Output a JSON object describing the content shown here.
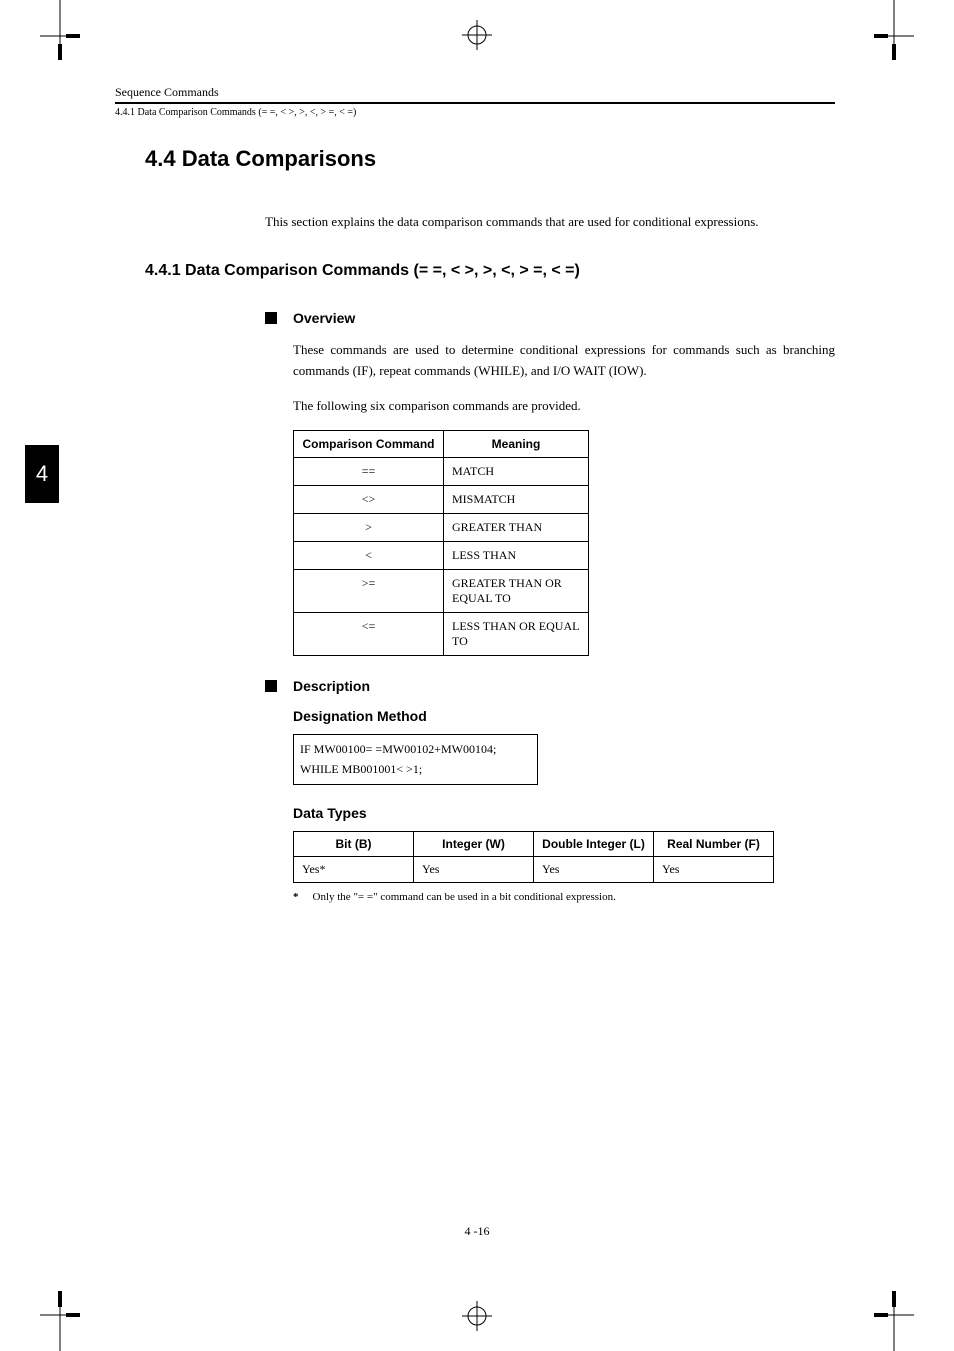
{
  "running_head": "Sequence Commands",
  "sub_head": "4.4.1  Data Comparison Commands (= =, < >, >, <, > =, < =)",
  "section_title": "4.4  Data Comparisons",
  "chapter_tab": "4",
  "intro_text": "This section explains the data comparison commands that are used for conditional expressions.",
  "subsection_title": "4.4.1  Data Comparison Commands (= =, < >, >, <, > =, < =)",
  "overview": {
    "heading": "Overview",
    "p1": "These commands are used to determine conditional expressions for commands such as branching commands (IF), repeat commands (WHILE), and I/O WAIT (IOW).",
    "p2": "The following six comparison commands are provided."
  },
  "comparison_table": {
    "headers": {
      "cmd": "Comparison Command",
      "mean": "Meaning"
    },
    "rows": [
      {
        "cmd": "==",
        "mean": "MATCH"
      },
      {
        "cmd": "<>",
        "mean": "MISMATCH"
      },
      {
        "cmd": ">",
        "mean": "GREATER THAN"
      },
      {
        "cmd": "<",
        "mean": "LESS THAN"
      },
      {
        "cmd": ">=",
        "mean": "GREATER THAN OR EQUAL TO"
      },
      {
        "cmd": "<=",
        "mean": "LESS THAN OR EQUAL TO"
      }
    ]
  },
  "description": {
    "heading": "Description",
    "designation_heading": "Designation Method",
    "code": {
      "line1": "IF    MW00100= =MW00102+MW00104;",
      "line2": "WHILE   MB001001< >1;"
    },
    "types_heading": "Data Types",
    "types_headers": {
      "b": "Bit (B)",
      "w": "Integer (W)",
      "l": "Double Integer (L)",
      "f": "Real Number (F)"
    },
    "types_row": {
      "b": "Yes*",
      "w": "Yes",
      "l": "Yes",
      "f": "Yes"
    },
    "footnote_mark": "*",
    "footnote_text": "Only the \"= =\" command can be used in a bit conditional expression."
  },
  "page_number": "4 -16"
}
